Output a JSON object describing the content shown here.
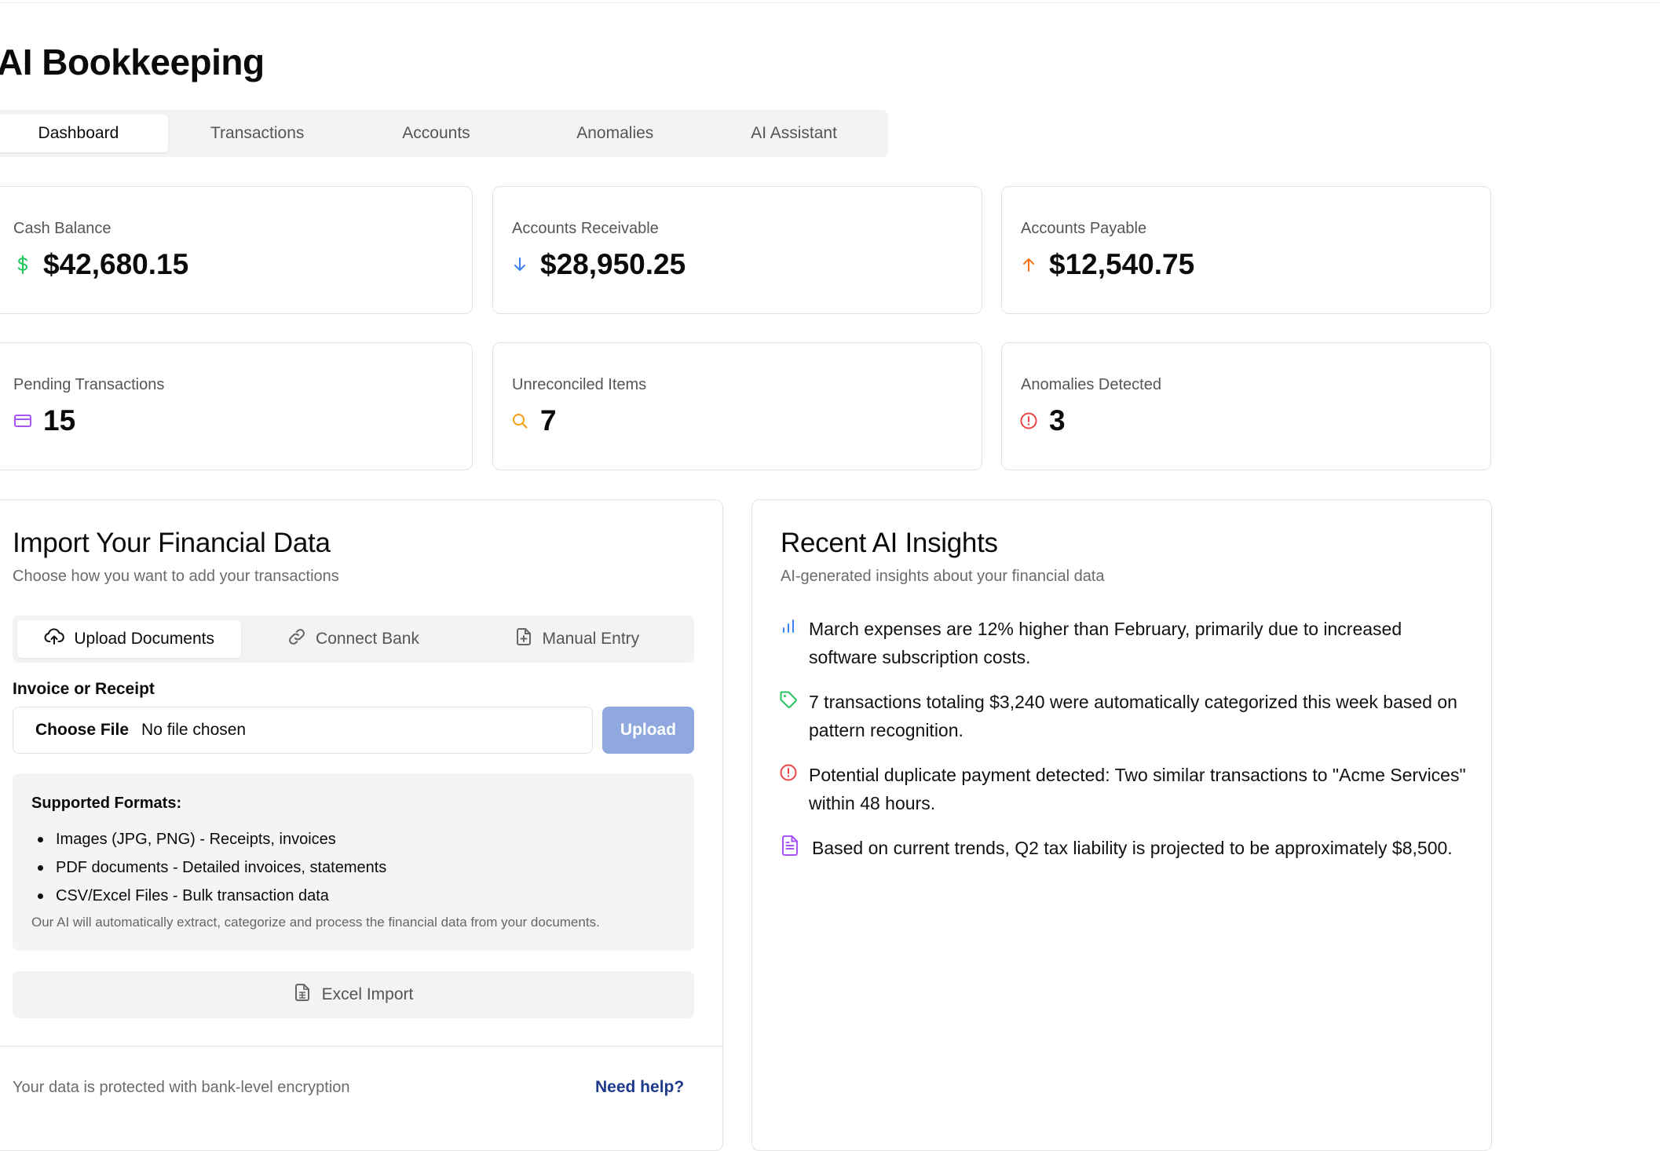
{
  "app": {
    "title": "AI Bookkeeping"
  },
  "tabs": [
    {
      "label": "Dashboard",
      "active": true
    },
    {
      "label": "Transactions"
    },
    {
      "label": "Accounts"
    },
    {
      "label": "Anomalies"
    },
    {
      "label": "AI Assistant"
    }
  ],
  "stats": {
    "cash_balance": {
      "label": "Cash Balance",
      "value": "$42,680.15",
      "icon": "dollar-icon"
    },
    "accounts_receivable": {
      "label": "Accounts Receivable",
      "value": "$28,950.25",
      "icon": "arrow-down-icon"
    },
    "accounts_payable": {
      "label": "Accounts Payable",
      "value": "$12,540.75",
      "icon": "arrow-up-icon"
    },
    "pending_transactions": {
      "label": "Pending Transactions",
      "value": "15",
      "icon": "credit-card-icon"
    },
    "unreconciled_items": {
      "label": "Unreconciled Items",
      "value": "7",
      "icon": "search-icon"
    },
    "anomalies_detected": {
      "label": "Anomalies Detected",
      "value": "3",
      "icon": "alert-circle-icon"
    }
  },
  "colors": {
    "green": "#22c55e",
    "blue": "#3b82f6",
    "orange": "#f97316",
    "purple": "#a855f7",
    "amber": "#f59e0b",
    "red": "#ef4444",
    "upload_button": "#8fa9df",
    "link": "#1e3a8a"
  },
  "import": {
    "title": "Import Your Financial Data",
    "subtitle": "Choose how you want to add your transactions",
    "tabs": [
      {
        "label": "Upload Documents",
        "icon": "cloud-upload-icon",
        "active": true
      },
      {
        "label": "Connect Bank",
        "icon": "link-icon"
      },
      {
        "label": "Manual Entry",
        "icon": "file-plus-icon"
      }
    ],
    "field_label": "Invoice or Receipt",
    "file_button": "Choose File",
    "file_status": "No file chosen",
    "upload_label": "Upload",
    "formats_title": "Supported Formats:",
    "formats": [
      "Images (JPG, PNG) - Receipts, invoices",
      "PDF documents - Detailed invoices, statements",
      "CSV/Excel Files - Bulk transaction data"
    ],
    "formats_note": "Our AI will automatically extract, categorize and process the financial data from your documents.",
    "excel_label": "Excel Import",
    "footer_note": "Your data is protected with bank-level encryption",
    "help_link": "Need help?"
  },
  "insights": {
    "title": "Recent AI Insights",
    "subtitle": "AI-generated insights about your financial data",
    "items": [
      {
        "icon": "bar-chart-icon",
        "text": "March expenses are 12% higher than February, primarily due to increased software subscription costs."
      },
      {
        "icon": "tag-icon",
        "text": "7 transactions totaling $3,240 were automatically categorized this week based on pattern recognition."
      },
      {
        "icon": "alert-circle-icon",
        "text": "Potential duplicate payment detected: Two similar transactions to \"Acme Services\" within 48 hours."
      },
      {
        "icon": "file-text-icon",
        "text": "Based on current trends, Q2 tax liability is projected to be approximately $8,500."
      }
    ]
  }
}
